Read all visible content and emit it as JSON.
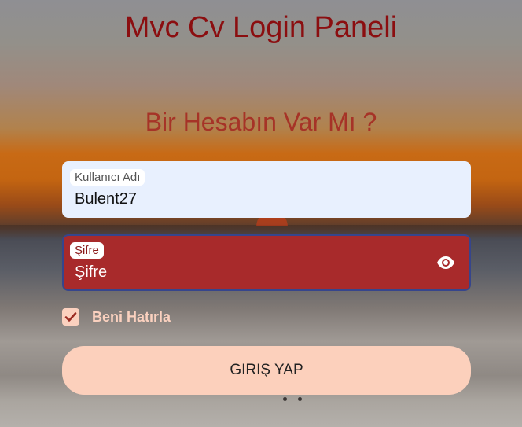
{
  "header": {
    "title": "Mvc Cv Login Paneli"
  },
  "form": {
    "subtitle": "Bir Hesabın Var Mı ?",
    "username": {
      "label": "Kullanıcı Adı",
      "value": "Bulent27"
    },
    "password": {
      "label": "Şifre",
      "placeholder": "Şifre",
      "icon": "eye-icon"
    },
    "remember": {
      "label": "Beni Hatırla",
      "checked": true
    },
    "submit_label": "GIRIŞ YAP"
  },
  "colors": {
    "title": "#8b0e10",
    "subtitle": "#a63327",
    "password_field": "#a82a2b",
    "button": "#fcd0bc"
  }
}
